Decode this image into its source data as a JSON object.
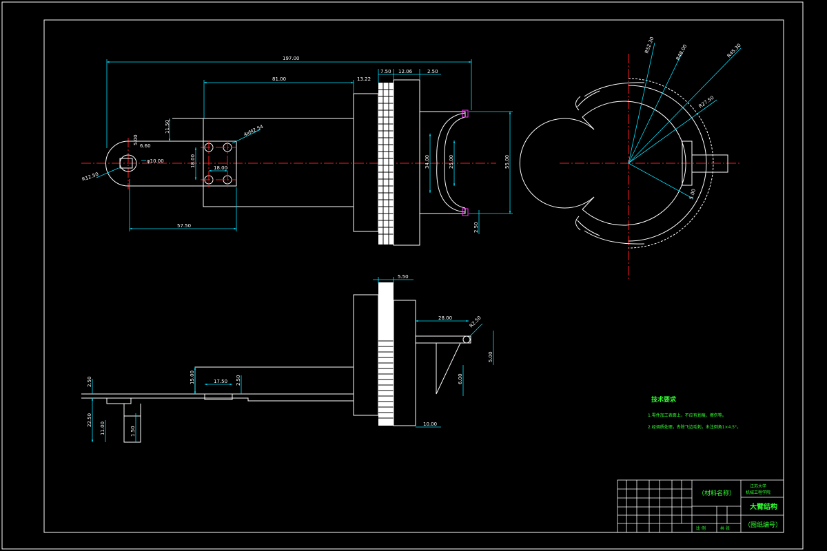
{
  "drawing": {
    "dimensions": {
      "overall_length": "197.00",
      "body_length": "81.00",
      "d13_22": "13.22",
      "d7_50": "7.50",
      "d12_06": "12.06",
      "d2_50_top": "2.50",
      "d11_50": "11.50",
      "d5_00": "5.00",
      "d6_60": "6.60",
      "phi10": "φ10.00",
      "r12_50": "R12.50",
      "holes": "4xM2.54",
      "d18_00_v": "18.00",
      "d18_00_h": "18.00",
      "d57_50": "57.50",
      "d34_00": "34.00",
      "d25_00": "25.00",
      "d55_00": "55.00",
      "d2_50_right": "2.50",
      "r52_30": "R52.30",
      "r48_00": "R48.00",
      "r45_30": "R45.30",
      "r27_50": "R27.50",
      "d5_00_gear": "5.00",
      "d5_50": "5.50",
      "d28_00": "28.00",
      "r2_50": "R2.50",
      "d5_00_side": "5.00",
      "d6_00": "6.00",
      "d10_00": "10.00",
      "d2_50_a": "2.50",
      "d15_00": "15.00",
      "d17_50": "17.50",
      "d2_50_b": "2.50",
      "d22_50": "22.50",
      "d11_00": "11.00",
      "d1_50": "1.50"
    },
    "tech_requirements": {
      "title": "技术要求",
      "line1": "1.零件加工表面上，不应有划痕、擦伤等。",
      "line2": "2.经调质处理，去除飞边毛刺，未注倒角1×4.5°。"
    },
    "title_block": {
      "material": "（材料名称）",
      "school_line1": "江苏大学",
      "school_line2": "机械工程学院",
      "part_name": "大臂结构",
      "drawing_no": "（图纸编号）",
      "ratio": "比 例",
      "sheet": "共 张"
    }
  }
}
